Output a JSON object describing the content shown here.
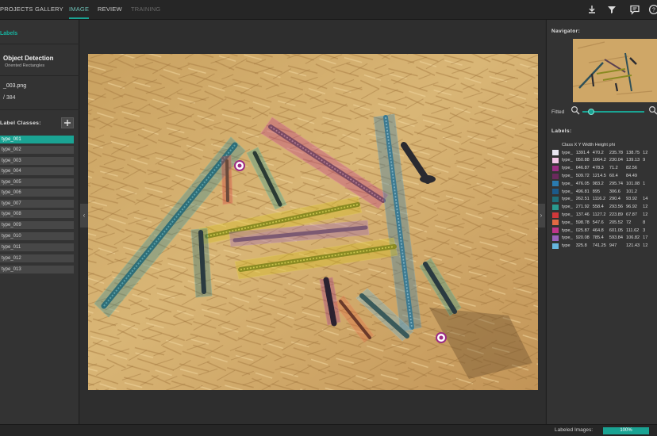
{
  "topnav": {
    "projects": "PROJECTS",
    "gallery": "GALLERY",
    "image": "IMAGE",
    "review": "REVIEW",
    "training": "TRAINING"
  },
  "sidebar": {
    "section_header": "Labels",
    "project_title": "Object Detection",
    "project_subtitle": "Oriented Rectangles",
    "image_name": "_003.png",
    "image_counter": "/ 384",
    "label_classes_title": "Label Classes:",
    "classes": [
      "type_001",
      "type_002",
      "type_003",
      "type_004",
      "type_005",
      "type_006",
      "type_007",
      "type_008",
      "type_009",
      "type_010",
      "type_011",
      "type_012",
      "type_013"
    ],
    "selected_index": 0
  },
  "navigator": {
    "title": "Navigator:",
    "fitted_label": "Fitted",
    "zoom_level": 0.1
  },
  "labels_panel": {
    "title": "Labels:",
    "headers": [
      "Class",
      "X",
      "Y",
      "Width",
      "Height",
      "phi"
    ],
    "header_text": "Class     X     Y  Width Height phi",
    "rows": [
      {
        "cls": "type_",
        "x": "1391.4",
        "y": "470.2",
        "w": "235.78",
        "h": "138.75",
        "phi": "12",
        "color": "#e9e6f0"
      },
      {
        "cls": "type_",
        "x": "050.88",
        "y": "1064.2",
        "w": "230.04",
        "h": "139.13",
        "phi": "9",
        "color": "#f4c6e6"
      },
      {
        "cls": "type_",
        "x": "646.87",
        "y": "478.3",
        "w": "71.2",
        "h": "82.56",
        "phi": "",
        "color": "#9c2d83"
      },
      {
        "cls": "type_",
        "x": "509.72",
        "y": "1214.5",
        "w": "60.4",
        "h": "84.49",
        "phi": "",
        "color": "#6a2a5c"
      },
      {
        "cls": "type_",
        "x": "476.05",
        "y": "983.2",
        "w": "295.74",
        "h": "101.08",
        "phi": "1",
        "color": "#2a7bb0"
      },
      {
        "cls": "type_",
        "x": "496.81",
        "y": "895",
        "w": "306.6",
        "h": "101.2",
        "phi": "",
        "color": "#1b5a8a"
      },
      {
        "cls": "type_",
        "x": "262.51",
        "y": "1116.2",
        "w": "290.4",
        "h": "93.92",
        "phi": "14",
        "color": "#1e6f7a"
      },
      {
        "cls": "type_",
        "x": "271.92",
        "y": "558.4",
        "w": "293.56",
        "h": "96.92",
        "phi": "12",
        "color": "#2a9a8f"
      },
      {
        "cls": "type_",
        "x": "137.46",
        "y": "1127.2",
        "w": "223.89",
        "h": "67.87",
        "phi": "12",
        "color": "#d2383a"
      },
      {
        "cls": "type_",
        "x": "598.78",
        "y": "547.6",
        "w": "205.52",
        "h": "72",
        "phi": "8",
        "color": "#e26a43"
      },
      {
        "cls": "type_",
        "x": "025.87",
        "y": "464.8",
        "w": "601.05",
        "h": "111.62",
        "phi": "3",
        "color": "#c0358a"
      },
      {
        "cls": "type_",
        "x": "920.08",
        "y": "785.4",
        "w": "593.84",
        "h": "106.82",
        "phi": "17",
        "color": "#9a62bb"
      },
      {
        "cls": "type",
        "x": "325.8",
        "y": "741.25",
        "w": "947",
        "h": "121.43",
        "phi": "12",
        "color": "#66b5de"
      }
    ]
  },
  "status": {
    "labeled_images_label": "Labeled Images:",
    "labeled_images_value": "100%",
    "labeled_fraction": 1.0
  },
  "colors": {
    "accent": "#1aa393",
    "panel": "#333333",
    "background": "#2b2b2b"
  },
  "icons": [
    "download-icon",
    "filter-icon",
    "comment-icon",
    "help-icon",
    "add-icon",
    "zoom-out-icon",
    "zoom-in-icon",
    "collapse-left-icon",
    "collapse-right-icon"
  ]
}
